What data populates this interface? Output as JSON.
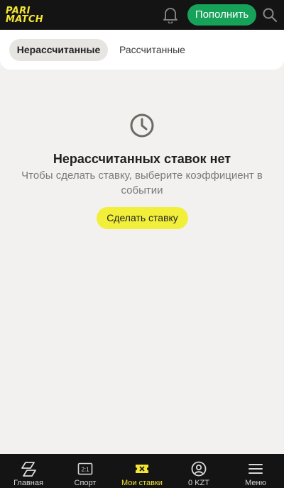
{
  "header": {
    "logo_line1": "PARI",
    "logo_line2": "MATCH",
    "topup_label": "Пополнить",
    "icons": [
      "bell-icon",
      "search-icon"
    ]
  },
  "tabs": {
    "active_label": "Нерассчитанные",
    "other_label": "Рассчитанные"
  },
  "empty_state": {
    "icon": "clock-icon",
    "title": "Нерассчитанных ставок нет",
    "subtitle": "Чтобы сделать ставку, выберите коэффициент в событии",
    "button_label": "Сделать ставку"
  },
  "bottom_nav": {
    "items": [
      {
        "label": "Главная",
        "icon": "home-icon"
      },
      {
        "label": "Спорт",
        "icon": "scoreboard-icon"
      },
      {
        "label": "Мои ставки",
        "icon": "ticket-icon",
        "active": true
      },
      {
        "label": "0 KZT",
        "icon": "account-icon"
      },
      {
        "label": "Меню",
        "icon": "menu-icon"
      }
    ]
  },
  "colors": {
    "header_bg": "#141414",
    "brand_yellow": "#f4e534",
    "topup_green": "#17a25a",
    "page_bg": "#f2f1f0",
    "bet_button_yellow": "#f1ef3a"
  }
}
